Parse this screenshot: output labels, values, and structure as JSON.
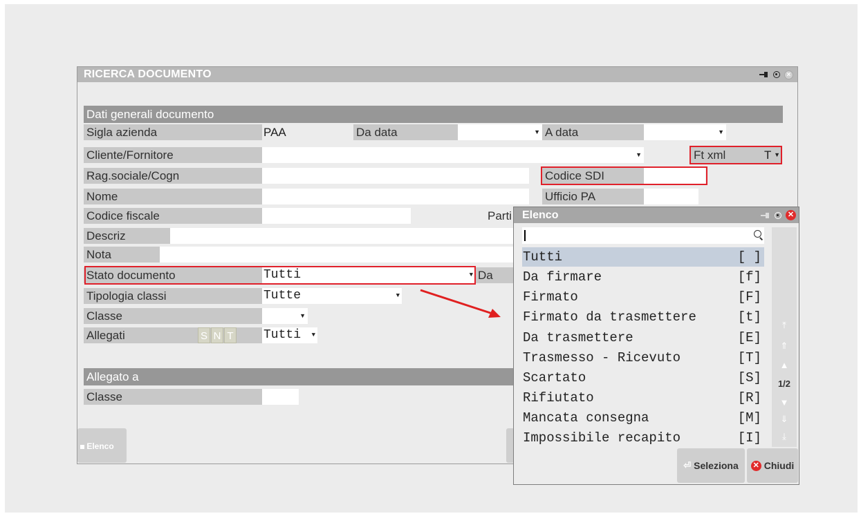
{
  "window": {
    "title": "RICERCA DOCUMENTO"
  },
  "section_general": "Dati generali documento",
  "fields": {
    "sigla_azienda": {
      "label": "Sigla azienda",
      "value": "PAA"
    },
    "da_data": {
      "label": "Da data",
      "value": ""
    },
    "a_data": {
      "label": "A data",
      "value": ""
    },
    "cliente_fornitore": {
      "label": "Cliente/Fornitore",
      "value": ""
    },
    "ft_xml": {
      "label": "Ft xml",
      "value": "T"
    },
    "rag_sociale": {
      "label": "Rag.sociale/Cogn",
      "value": ""
    },
    "codice_sdi": {
      "label": "Codice SDI",
      "value": ""
    },
    "nome": {
      "label": "Nome",
      "value": ""
    },
    "ufficio_pa": {
      "label": "Ufficio PA",
      "value": ""
    },
    "codice_fiscale": {
      "label": "Codice fiscale",
      "value": ""
    },
    "partita_iva": {
      "label": "Parti"
    },
    "descriz": {
      "label": "Descriz",
      "value": ""
    },
    "nota": {
      "label": "Nota",
      "value": ""
    },
    "stato_documento": {
      "label": "Stato documento",
      "value": "Tutti"
    },
    "stato_da": {
      "label": "Da"
    },
    "tipologia_classi": {
      "label": "Tipologia classi",
      "value": "Tutte"
    },
    "classe": {
      "label": "Classe",
      "value": ""
    },
    "allegati": {
      "label": "Allegati",
      "flags": [
        "S",
        "N",
        "T"
      ],
      "value": "Tutti"
    }
  },
  "section_allegato": "Allegato a",
  "allegato_classe": {
    "label": "Classe",
    "value": ""
  },
  "buttons": {
    "elenco": "Elenco"
  },
  "popup": {
    "title": "Elenco",
    "search_value": "",
    "items": [
      {
        "label": "Tutti",
        "key": "[ ]",
        "selected": true
      },
      {
        "label": "Da firmare",
        "key": "[f]"
      },
      {
        "label": "Firmato",
        "key": "[F]"
      },
      {
        "label": "Firmato da trasmettere",
        "key": "[t]"
      },
      {
        "label": "Da trasmettere",
        "key": "[E]"
      },
      {
        "label": "Trasmesso - Ricevuto",
        "key": "[T]"
      },
      {
        "label": "Scartato",
        "key": "[S]"
      },
      {
        "label": "Rifiutato",
        "key": "[R]"
      },
      {
        "label": "Mancata consegna",
        "key": "[M]"
      },
      {
        "label": "Impossibile recapito",
        "key": "[I]"
      }
    ],
    "page": "1/2",
    "seleziona": "Seleziona",
    "chiudi": "Chiudi"
  },
  "colors": {
    "highlight": "#e0202a",
    "selected_row": "#c5cfdc",
    "arrow": "#e02020"
  }
}
